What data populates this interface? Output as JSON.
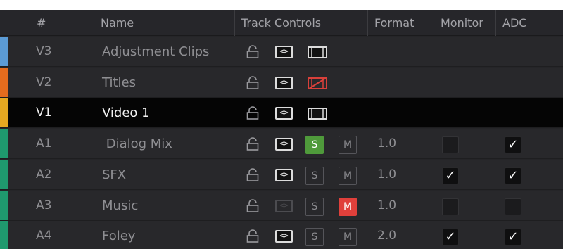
{
  "columns": {
    "num": "#",
    "name": "Name",
    "track_controls": "Track Controls",
    "format": "Format",
    "monitor": "Monitor",
    "adc": "ADC"
  },
  "colors": {
    "v3": "#5b9bd5",
    "v2": "#e46c1e",
    "v1": "#e5a821",
    "audio": "#1f9a6e",
    "solo_active": "#4f9a3b",
    "mute_active": "#e0403b",
    "disabled_video": "#d9403a"
  },
  "tracks": [
    {
      "id": "V3",
      "name": "Adjustment Clips",
      "kind": "video",
      "video_enabled": true,
      "selected": false
    },
    {
      "id": "V2",
      "name": "Titles",
      "kind": "video",
      "video_enabled": false,
      "selected": false
    },
    {
      "id": "V1",
      "name": "Video 1",
      "kind": "video",
      "video_enabled": true,
      "selected": true
    },
    {
      "id": "A1",
      "name": " Dialog Mix",
      "kind": "audio",
      "solo": true,
      "mute": false,
      "format": "1.0",
      "monitor": false,
      "adc": true
    },
    {
      "id": "A2",
      "name": "SFX",
      "kind": "audio",
      "solo": false,
      "mute": false,
      "format": "1.0",
      "monitor": true,
      "adc": true
    },
    {
      "id": "A3",
      "name": "Music",
      "kind": "audio",
      "solo": false,
      "mute": true,
      "format": "1.0",
      "monitor": false,
      "adc": false,
      "auto_dim": true
    },
    {
      "id": "A4",
      "name": "Foley",
      "kind": "audio",
      "solo": false,
      "mute": false,
      "format": "2.0",
      "monitor": true,
      "adc": true
    }
  ],
  "labels": {
    "solo": "S",
    "mute": "M",
    "auto": "<>",
    "check": "✓"
  },
  "icons": {
    "lock": "lock-icon",
    "auto_select": "auto-select-icon",
    "video_enable": "film-icon",
    "video_disabled": "film-disabled-icon"
  }
}
